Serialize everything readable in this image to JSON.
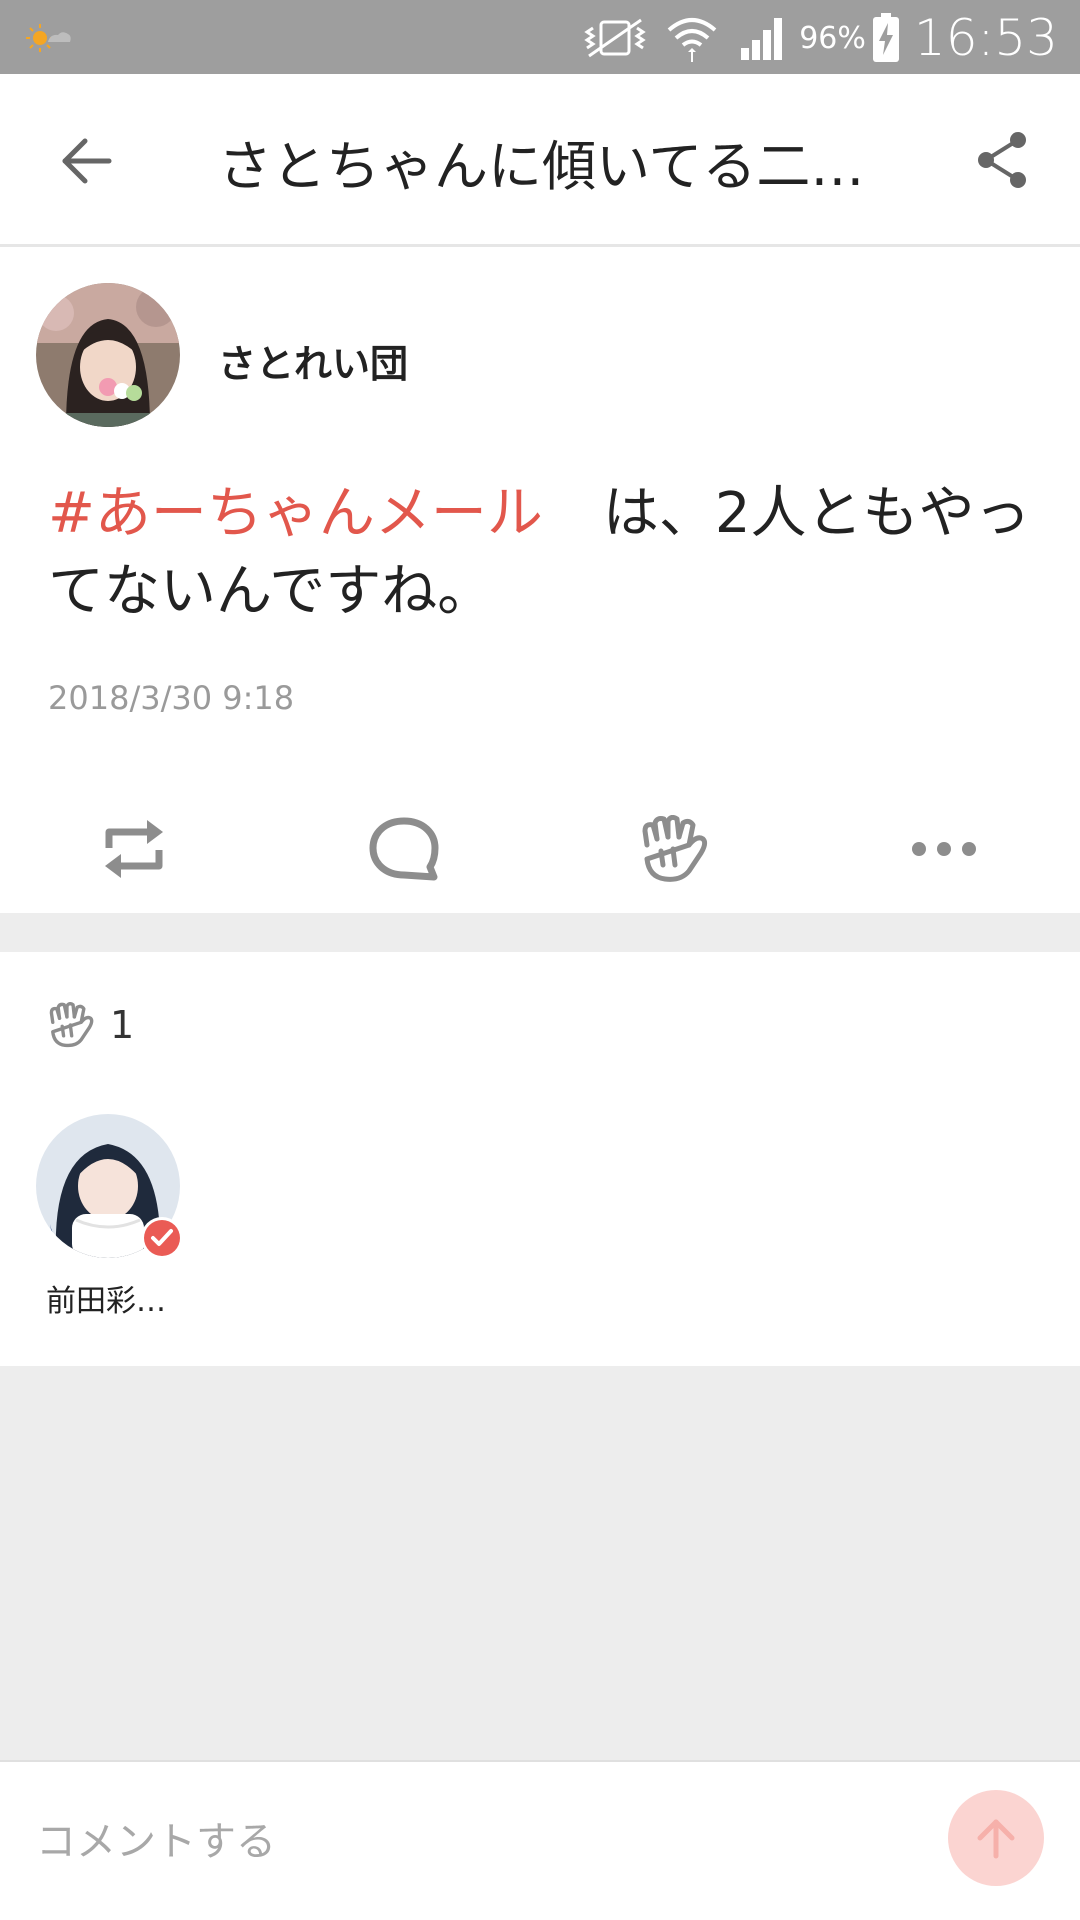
{
  "status_bar": {
    "battery_percent": "96%",
    "time": "16:53"
  },
  "header": {
    "title": "さとちゃんに傾いてる二…",
    "back_icon": "arrow-left-icon",
    "share_icon": "share-icon"
  },
  "post": {
    "author_name": "さとれい団",
    "hashtag": "#あーちゃんメール",
    "body": "は、2人ともやってないんですね。",
    "timestamp": "2018/3/30 9:18",
    "actions": [
      "repost-icon",
      "comment-icon",
      "clap-icon",
      "more-icon"
    ]
  },
  "likes": {
    "count": "1",
    "users": [
      {
        "name": "前田彩…",
        "verified": true
      }
    ]
  },
  "comment": {
    "placeholder": "コメントする"
  },
  "colors": {
    "accent": "#e2574c",
    "status_bar": "#9e9e9e",
    "separator": "#ededed",
    "send_button": "#fbd4d1"
  }
}
